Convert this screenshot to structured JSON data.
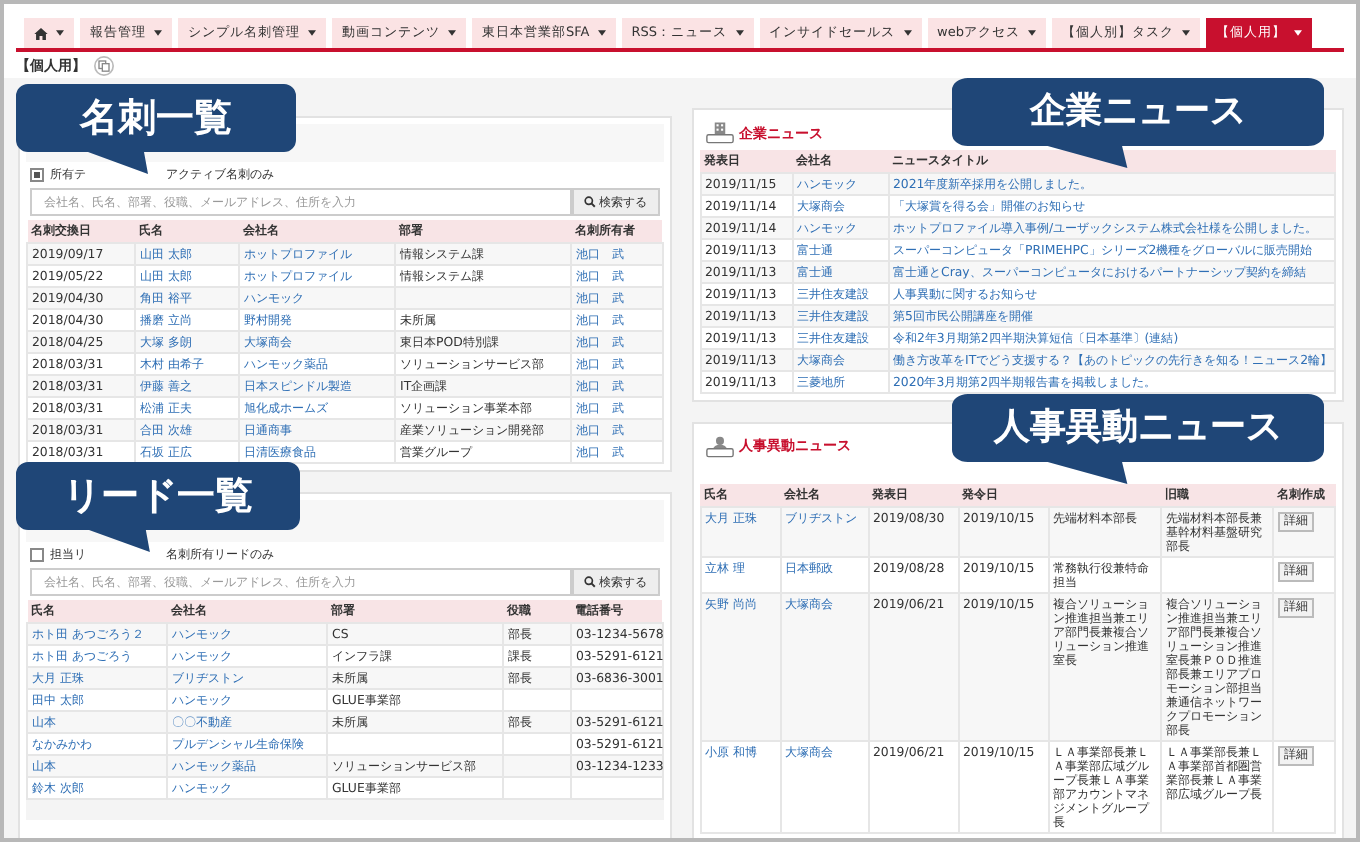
{
  "menu": {
    "tabs": [
      {
        "kind": "home",
        "selected": false
      },
      {
        "label": "報告管理",
        "selected": false
      },
      {
        "label": "シンプル名刺管理",
        "selected": false
      },
      {
        "label": "動画コンテンツ",
        "selected": false
      },
      {
        "label": "東日本営業部SFA",
        "selected": false
      },
      {
        "label": "RSS：ニュース",
        "selected": false
      },
      {
        "label": "インサイドセールス",
        "selected": false
      },
      {
        "label": "webアクセス",
        "selected": false
      },
      {
        "label": "【個人別】タスク",
        "selected": false
      },
      {
        "label": "【個人用】",
        "selected": true
      }
    ]
  },
  "page_title": "【個人用】",
  "business_cards": {
    "filters": [
      {
        "label": "所有テ",
        "checked": true
      },
      {
        "label": "アクティブ名刺のみ"
      }
    ],
    "search": {
      "placeholder": "会社名、氏名、部署、役職、メールアドレス、住所を入力",
      "button": "検索する"
    },
    "columns": [
      "名刺交換日",
      "氏名",
      "会社名",
      "部署",
      "名刺所有者"
    ],
    "rows": [
      {
        "date": "2019/09/17",
        "name": "山田 太郎",
        "company": "ホットプロファイル",
        "dept": "情報システム課",
        "owner": "池口　武"
      },
      {
        "date": "2019/05/22",
        "name": "山田 太郎",
        "company": "ホットプロファイル",
        "dept": "情報システム課",
        "owner": "池口　武"
      },
      {
        "date": "2019/04/30",
        "name": "角田 裕平",
        "company": "ハンモック",
        "owner": "池口　武"
      },
      {
        "date": "2018/04/30",
        "name": "播磨 立尚",
        "company": "野村開発",
        "dept": "未所属",
        "owner": "池口　武"
      },
      {
        "date": "2018/04/25",
        "name": "大塚 多朗",
        "company": "大塚商会",
        "dept": "東日本POD特別課",
        "owner": "池口　武"
      },
      {
        "date": "2018/03/31",
        "name": "木村 由希子",
        "company": "ハンモック薬品",
        "dept": "ソリューションサービス部",
        "owner": "池口　武"
      },
      {
        "date": "2018/03/31",
        "name": "伊藤 善之",
        "company": "日本スピンドル製造",
        "dept": "IT企画課",
        "owner": "池口　武"
      },
      {
        "date": "2018/03/31",
        "name": "松浦 正夫",
        "company": "旭化成ホームズ",
        "dept": "ソリューション事業本部",
        "owner": "池口　武"
      },
      {
        "date": "2018/03/31",
        "name": "合田 次雄",
        "company": "日通商事",
        "dept": "産業ソリューション開発部",
        "owner": "池口　武"
      },
      {
        "date": "2018/03/31",
        "name": "石坂 正広",
        "company": "日清医療食品",
        "dept": "営業グループ",
        "owner": "池口　武"
      }
    ]
  },
  "leads": {
    "filters": [
      {
        "label": "担当リ",
        "checked": false
      },
      {
        "label": "名刺所有リードのみ"
      }
    ],
    "search": {
      "placeholder": "会社名、氏名、部署、役職、メールアドレス、住所を入力",
      "button": "検索する"
    },
    "columns": [
      "氏名",
      "会社名",
      "部署",
      "役職",
      "電話番号"
    ],
    "rows": [
      {
        "name": "ホト田 あつごろう２",
        "company": "ハンモック",
        "dept": "CS",
        "role": "部長",
        "phone": "03-1234-5678"
      },
      {
        "name": "ホト田 あつごろう",
        "company": "ハンモック",
        "dept": "インフラ課",
        "role": "課長",
        "phone": "03-5291-6121"
      },
      {
        "name": "大月 正珠",
        "company": "ブリヂストン",
        "dept": "未所属",
        "role": "部長",
        "phone": "03-6836-3001"
      },
      {
        "name": "田中 太郎",
        "company": "ハンモック",
        "dept": "GLUE事業部"
      },
      {
        "name": "山本",
        "company": "〇〇不動産",
        "dept": "未所属",
        "role": "部長",
        "phone": "03-5291-6121"
      },
      {
        "name": "なかみかわ",
        "company": "プルデンシャル生命保険",
        "phone": "03-5291-6121"
      },
      {
        "name": "山本",
        "company": "ハンモック薬品",
        "dept": "ソリューションサービス部",
        "phone": "03-1234-1233"
      },
      {
        "name": "鈴木 次郎",
        "company": "ハンモック",
        "dept": "GLUE事業部"
      }
    ]
  },
  "company_news": {
    "title": "企業ニュース",
    "columns": [
      "発表日",
      "会社名",
      "ニュースタイトル"
    ],
    "rows": [
      {
        "date": "2019/11/15",
        "company": "ハンモック",
        "title": "2021年度新卒採用を公開しました。"
      },
      {
        "date": "2019/11/14",
        "company": "大塚商会",
        "title": "「大塚賞を得る会」開催のお知らせ"
      },
      {
        "date": "2019/11/14",
        "company": "ハンモック",
        "title": "ホットプロファイル導入事例/ユーザックシステム株式会社様を公開しました。"
      },
      {
        "date": "2019/11/13",
        "company": "富士通",
        "title": "スーパーコンピュータ「PRIMEHPC」シリーズ2機種をグローバルに販売開始"
      },
      {
        "date": "2019/11/13",
        "company": "富士通",
        "title": "富士通とCray、スーパーコンピュータにおけるパートナーシップ契約を締結"
      },
      {
        "date": "2019/11/13",
        "company": "三井住友建設",
        "title": "人事異動に関するお知らせ"
      },
      {
        "date": "2019/11/13",
        "company": "三井住友建設",
        "title": "第5回市民公開講座を開催"
      },
      {
        "date": "2019/11/13",
        "company": "三井住友建設",
        "title": "令和2年3月期第2四半期決算短信〔日本基準〕(連結)"
      },
      {
        "date": "2019/11/13",
        "company": "大塚商会",
        "title": "働き方改革をITでどう支援する？【あのトピックの先行きを知る！ニュース2輪】"
      },
      {
        "date": "2019/11/13",
        "company": "三菱地所",
        "title": "2020年3月期第2四半期報告書を掲載しました。"
      }
    ]
  },
  "personnel_news": {
    "title": "人事異動ニュース",
    "columns": [
      {
        "label": "氏名"
      },
      {
        "label": "会社名"
      },
      {
        "label": "発表日"
      },
      {
        "label": "発令日"
      },
      {},
      {
        "label": "旧職"
      },
      {
        "label": "名刺作成"
      }
    ],
    "rows": [
      {
        "name": "大月 正珠",
        "company": "ブリヂストン",
        "announced": "2019/08/30",
        "effective": "2019/10/15",
        "new_post": "先端材料本部長",
        "old_post": "先端材料本部長兼基幹材料基盤研究部長",
        "action": "詳細"
      },
      {
        "name": "立林 理",
        "company": "日本郵政",
        "announced": "2019/08/28",
        "effective": "2019/10/15",
        "new_post": "常務執行役兼特命担当",
        "action": "詳細"
      },
      {
        "name": "矢野 尚尚",
        "company": "大塚商会",
        "announced": "2019/06/21",
        "effective": "2019/10/15",
        "new_post": "複合ソリューション推進担当兼エリア部門長兼複合ソリューション推進室長",
        "old_post": "複合ソリューション推進担当兼エリア部門長兼複合ソリューション推進室長兼ＰＯＤ推進部長兼エリアプロモーション部担当兼通信ネットワークプロモーション部長",
        "action": "詳細"
      },
      {
        "name": "小原 和博",
        "company": "大塚商会",
        "announced": "2019/06/21",
        "effective": "2019/10/15",
        "new_post": "ＬＡ事業部長兼ＬＡ事業部広域グループ長兼ＬＡ事業部アカウントマネジメントグループ長",
        "old_post": "ＬＡ事業部長兼ＬＡ事業部首都圏営業部長兼ＬＡ事業部広域グループ長",
        "action": "詳細"
      }
    ]
  },
  "callouts": [
    {
      "text": "名刺一覧"
    },
    {
      "text": "企業ニュース"
    },
    {
      "text": "人事異動ニュース"
    },
    {
      "text": "リード一覧"
    }
  ]
}
